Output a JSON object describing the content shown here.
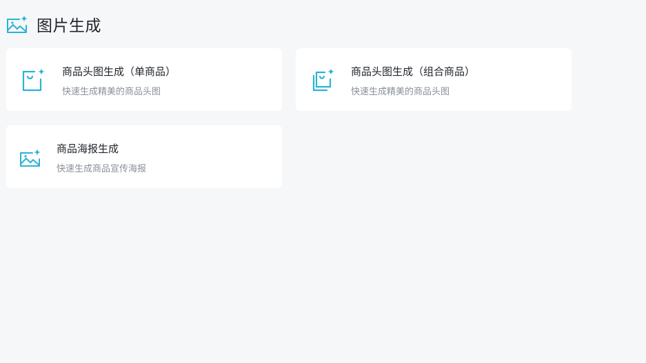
{
  "header": {
    "title": "图片生成",
    "icon": "image-sparkle-icon"
  },
  "accent_color": "#29b2d6",
  "cards": [
    {
      "title": "商品头图生成（单商品）",
      "desc": "快速生成精美的商品头图",
      "icon": "shopping-bag-sparkle-icon"
    },
    {
      "title": "商品头图生成（组合商品）",
      "desc": "快速生成精美的商品头图",
      "icon": "stacked-bags-sparkle-icon"
    },
    {
      "title": "商品海报生成",
      "desc": "快速生成商品宣传海报",
      "icon": "image-sparkle-icon"
    }
  ]
}
